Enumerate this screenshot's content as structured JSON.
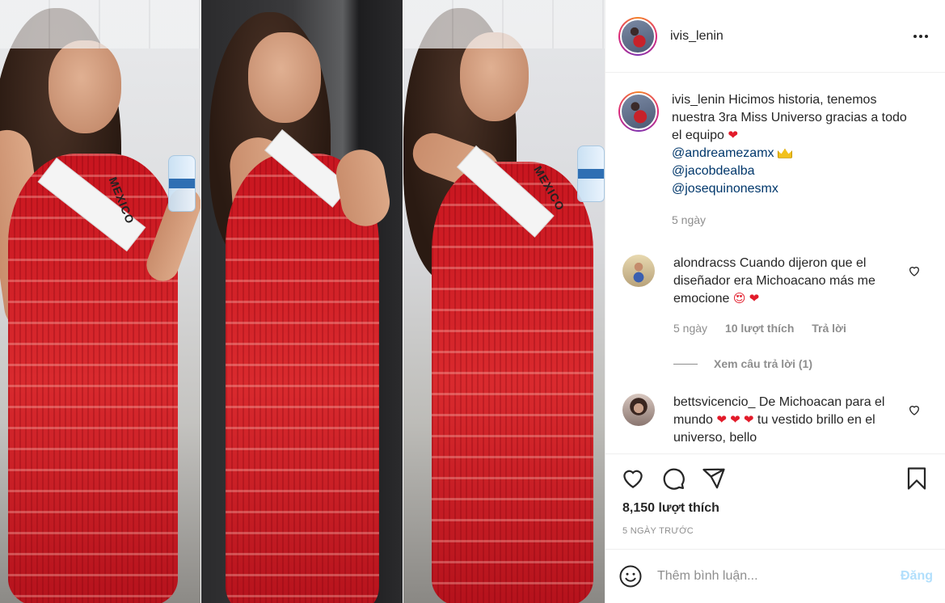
{
  "post": {
    "username": "ivis_lenin",
    "media": {
      "sash_text": "MEXICO",
      "panels": 3
    },
    "caption": {
      "username": "ivis_lenin",
      "text": "Hicimos historia, tenemos nuestra 3ra Miss Universo gracias a todo el equipo",
      "emoji": "❤",
      "mentions": [
        "@andreamezamx",
        "@jacobdealba",
        "@josequinonesmx"
      ],
      "time": "5 ngày"
    },
    "comments": [
      {
        "username": "alondracss",
        "text": "Cuando dijeron que el diseñador era Michoacano más me emocione",
        "emojis": "😍 ❤",
        "time": "5 ngày",
        "likes": "10 lượt thích",
        "reply_label": "Trả lời"
      },
      {
        "username": "bettsvicencio_",
        "text_part1": "De Michoacan para el mundo",
        "emojis": "❤ ❤ ❤",
        "text_part2": "tu vestido brillo en el universo, bello"
      }
    ],
    "view_replies": "Xem câu trả lời (1)",
    "likes_total": "8,150 lượt thích",
    "posted": "5 NGÀY TRƯỚC",
    "add_comment": {
      "placeholder": "Thêm bình luận...",
      "post_label": "Đăng"
    },
    "icons": [
      "heart-icon",
      "comment-icon",
      "share-icon",
      "bookmark-icon",
      "emoji-icon",
      "more-icon"
    ],
    "colors": {
      "link": "#00376b",
      "muted": "#8e8e8e",
      "post_button_disabled": "#b2dffc",
      "heart": "#e21b2a"
    }
  }
}
